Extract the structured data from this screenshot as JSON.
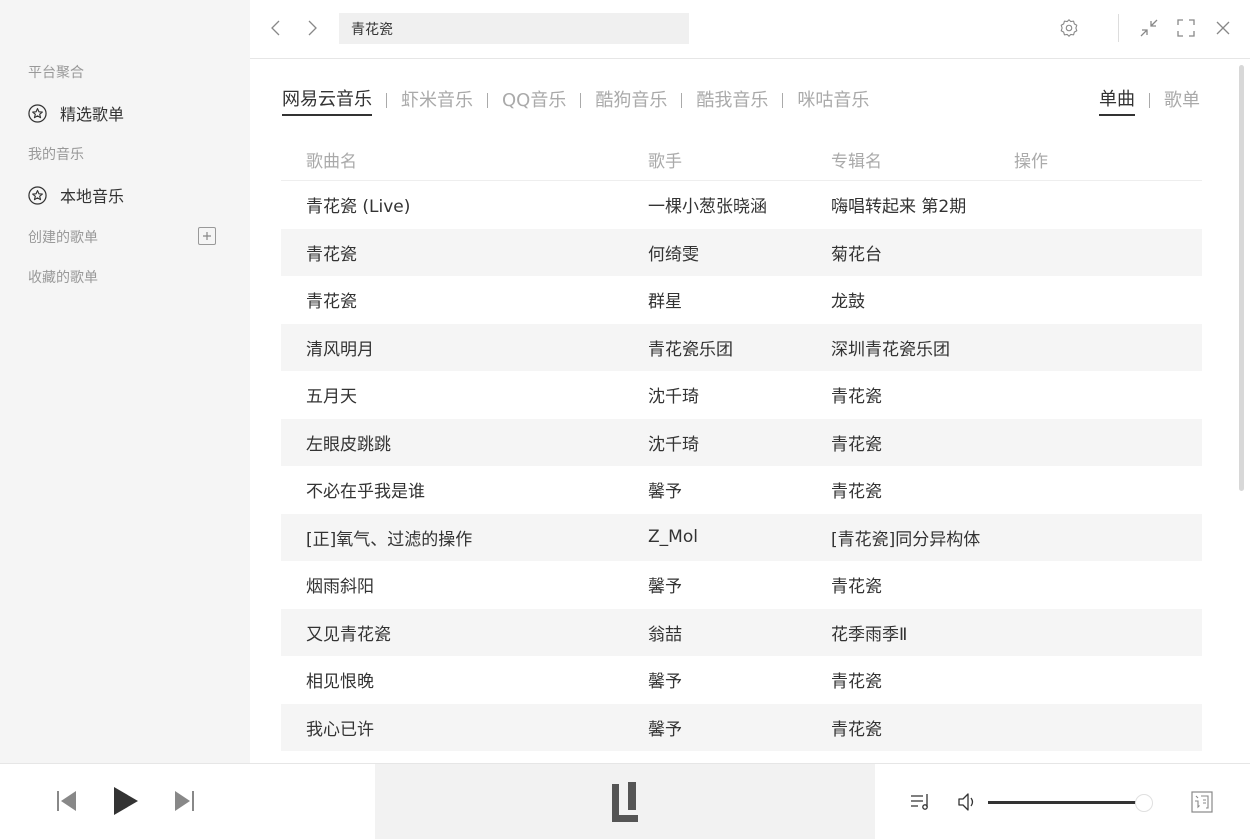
{
  "sidebar": {
    "section_platform": "平台聚合",
    "item_featured": "精选歌单",
    "section_my_music": "我的音乐",
    "item_local": "本地音乐",
    "section_created": "创建的歌单",
    "section_collected": "收藏的歌单"
  },
  "search": {
    "value": "青花瓷"
  },
  "platform_tabs": [
    "网易云音乐",
    "虾米音乐",
    "QQ音乐",
    "酷狗音乐",
    "酷我音乐",
    "咪咕音乐"
  ],
  "type_tabs": [
    "单曲",
    "歌单"
  ],
  "table": {
    "headers": [
      "歌曲名",
      "歌手",
      "专辑名",
      "操作"
    ],
    "rows": [
      {
        "title": "青花瓷 (Live)",
        "artist": "一棵小葱张晓涵",
        "album": "嗨唱转起来 第2期"
      },
      {
        "title": "青花瓷",
        "artist": "何绮雯",
        "album": "菊花台"
      },
      {
        "title": "青花瓷",
        "artist": "群星",
        "album": "龙鼓"
      },
      {
        "title": "清风明月",
        "artist": "青花瓷乐团",
        "album": "深圳青花瓷乐团"
      },
      {
        "title": "五月天",
        "artist": "沈千琦",
        "album": "青花瓷"
      },
      {
        "title": "左眼皮跳跳",
        "artist": "沈千琦",
        "album": "青花瓷"
      },
      {
        "title": "不必在乎我是谁",
        "artist": "馨予",
        "album": "青花瓷"
      },
      {
        "title": "[正]氧气、过滤的操作",
        "artist": "Z_Mol",
        "album": "[青花瓷]同分异构体"
      },
      {
        "title": "烟雨斜阳",
        "artist": "馨予",
        "album": "青花瓷"
      },
      {
        "title": "又见青花瓷",
        "artist": "翁喆",
        "album": "花季雨季Ⅱ"
      },
      {
        "title": "相见恨晚",
        "artist": "馨予",
        "album": "青花瓷"
      },
      {
        "title": "我心已许",
        "artist": "馨予",
        "album": "青花瓷"
      }
    ]
  },
  "player": {
    "volume": 0.95
  },
  "icons": {
    "featured": "star-circle-icon",
    "local": "star-circle-icon",
    "add": "plus-icon",
    "back": "chevron-left-icon",
    "forward": "chevron-right-icon",
    "settings": "gear-icon",
    "minimize": "shrink-icon",
    "maximize": "fullscreen-icon",
    "close": "close-icon",
    "prev": "skip-previous-icon",
    "play": "play-icon",
    "next": "skip-next-icon",
    "logo": "app-logo-icon",
    "playlist": "playlist-icon",
    "volume": "volume-icon",
    "lyrics": "lyrics-icon"
  },
  "colors": {
    "accent": "#333333",
    "sidebar_bg": "#f5f5f5",
    "row_alt": "#f5f5f5",
    "muted": "#aaaaaa"
  }
}
